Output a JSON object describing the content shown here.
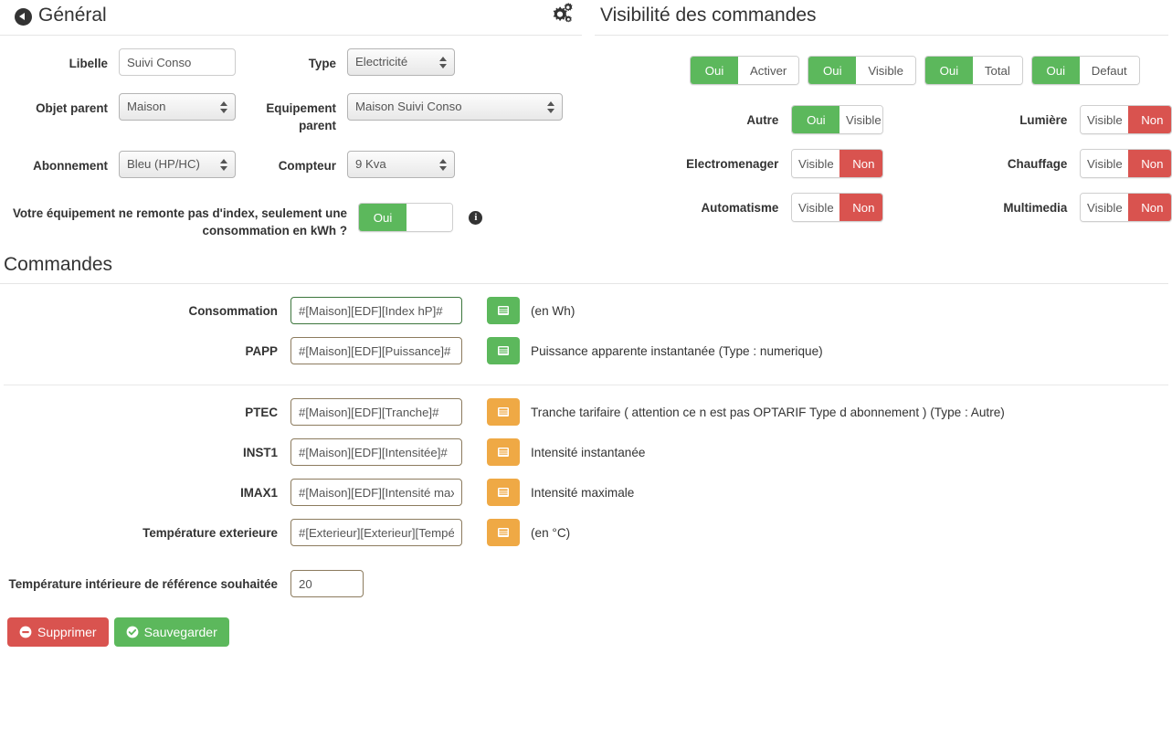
{
  "general": {
    "title": "Général",
    "back_icon": "back-arrow-icon",
    "gear_icon": "gears-icon",
    "fields": {
      "libelle_label": "Libelle",
      "libelle_value": "Suivi Conso",
      "type_label": "Type",
      "type_value": "Electricité",
      "objet_parent_label": "Objet parent",
      "objet_parent_value": "Maison",
      "equipement_parent_label": "Equipement parent",
      "equipement_parent_value": "Maison Suivi Conso",
      "abonnement_label": "Abonnement",
      "abonnement_value": "Bleu (HP/HC)",
      "compteur_label": "Compteur",
      "compteur_value": "9 Kva",
      "index_question_label": "Votre équipement ne remonte pas d'index, seulement une consommation en kWh ?",
      "index_toggle_on": "Oui",
      "info_icon": "info-icon"
    }
  },
  "visibility": {
    "title": "Visibilité des commandes",
    "top_toggles": [
      {
        "on": "Oui",
        "off": "Activer",
        "state": "on"
      },
      {
        "on": "Oui",
        "off": "Visible",
        "state": "on"
      },
      {
        "on": "Oui",
        "off": "Total",
        "state": "on"
      },
      {
        "on": "Oui",
        "off": "Defaut",
        "state": "on"
      }
    ],
    "rows": [
      {
        "left": {
          "label": "Autre",
          "on": "Oui",
          "off": "Visible",
          "state": "on"
        },
        "right": {
          "label": "Lumière",
          "on": "Visible",
          "off": "Non",
          "state": "off"
        }
      },
      {
        "left": {
          "label": "Electromenager",
          "on": "Visible",
          "off": "Non",
          "state": "off"
        },
        "right": {
          "label": "Chauffage",
          "on": "Visible",
          "off": "Non",
          "state": "off"
        }
      },
      {
        "left": {
          "label": "Automatisme",
          "on": "Visible",
          "off": "Non",
          "state": "off"
        },
        "right": {
          "label": "Multimedia",
          "on": "Visible",
          "off": "Non",
          "state": "off"
        }
      }
    ]
  },
  "commandes": {
    "title": "Commandes",
    "group1": [
      {
        "label": "Consommation",
        "value": "#[Maison][EDF][Index hP]#",
        "border": "green",
        "btn_color": "green",
        "btn_icon": "list-icon",
        "desc": "(en Wh)"
      },
      {
        "label": "PAPP",
        "value": "#[Maison][EDF][Puissance]#",
        "border": "default",
        "btn_color": "green",
        "btn_icon": "list-icon",
        "desc": "Puissance apparente instantanée (Type : numerique)"
      }
    ],
    "group2": [
      {
        "label": "PTEC",
        "value": "#[Maison][EDF][Tranche]#",
        "border": "default",
        "btn_color": "orange",
        "btn_icon": "list-icon",
        "desc": "Tranche tarifaire ( attention ce n est pas OPTARIF Type d abonnement ) (Type : Autre)"
      },
      {
        "label": "INST1",
        "value": "#[Maison][EDF][Intensitée]#",
        "border": "default",
        "btn_color": "orange",
        "btn_icon": "list-icon",
        "desc": "Intensité instantanée"
      },
      {
        "label": "IMAX1",
        "value": "#[Maison][EDF][Intensité maxi]#",
        "border": "default",
        "btn_color": "orange",
        "btn_icon": "list-icon",
        "desc": "Intensité maximale"
      },
      {
        "label": "Température exterieure",
        "value": "#[Exterieur][Exterieur][Température]#",
        "border": "default",
        "btn_color": "orange",
        "btn_icon": "list-icon",
        "desc": "(en °C)"
      }
    ],
    "temp_ref_label": "Température intérieure de référence souhaitée",
    "temp_ref_value": "20"
  },
  "actions": {
    "delete_label": "Supprimer",
    "delete_icon": "minus-circle-icon",
    "save_label": "Sauvegarder",
    "save_icon": "check-circle-icon"
  },
  "colors": {
    "green": "#5cb85c",
    "red": "#d9534f",
    "orange": "#eea236",
    "text": "#333333",
    "border": "#8c7b5e"
  }
}
